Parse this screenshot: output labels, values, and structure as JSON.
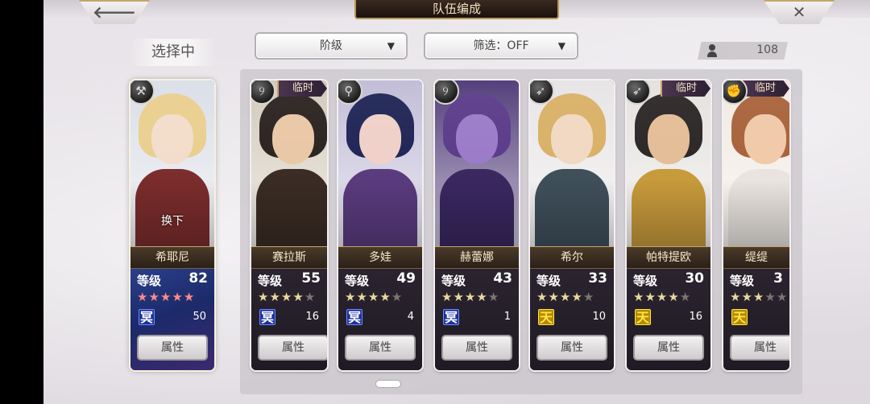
{
  "header": {
    "title": "队伍编成",
    "back_glyph": "🡐",
    "close_glyph": "✕"
  },
  "selecting_label": "选择中",
  "dropdowns": {
    "rank": {
      "label": "阶级",
      "caret": "▼"
    },
    "filter": {
      "label": "筛选：OFF",
      "caret": "▼"
    }
  },
  "roster_count": "108",
  "level_label": "等级",
  "attribute_label": "属性",
  "temp_label": "临时",
  "swap_label": "换下",
  "selected_card": {
    "name": "希耶尼",
    "level": "82",
    "stars": 5,
    "element": "冥",
    "element_type": "dark",
    "element_count": "50",
    "class_icon": "hammer-class-icon",
    "class_glyph": "⚒",
    "palette": {
      "hair": "#e9cf8e",
      "skin": "#f3dcca",
      "body": "#7b2c2c",
      "bg": "#d9dde6"
    }
  },
  "cards": [
    {
      "name": "赛拉斯",
      "level": "55",
      "stars": 4,
      "element": "冥",
      "element_type": "dark",
      "element_count": "16",
      "temp": true,
      "class_icon": "rod-class-icon",
      "class_glyph": "୨",
      "palette": {
        "hair": "#2a221f",
        "skin": "#e9c7a6",
        "body": "#3a2c24",
        "bg": "#d0c7b6"
      }
    },
    {
      "name": "多娃",
      "level": "49",
      "stars": 4,
      "element": "冥",
      "element_type": "dark",
      "element_count": "4",
      "temp": false,
      "class_icon": "staff-class-icon",
      "class_glyph": "⚲",
      "palette": {
        "hair": "#1e2454",
        "skin": "#f0d0c8",
        "body": "#5a3b7e",
        "bg": "#bfbad6"
      }
    },
    {
      "name": "赫蕾娜",
      "level": "43",
      "stars": 4,
      "element": "冥",
      "element_type": "dark",
      "element_count": "1",
      "temp": false,
      "class_icon": "rod-class-icon",
      "class_glyph": "୨",
      "palette": {
        "hair": "#5a3a8a",
        "skin": "#9a7ac8",
        "body": "#3a2760",
        "bg": "#4a3574"
      }
    },
    {
      "name": "希尔",
      "level": "33",
      "stars": 4,
      "element": "天",
      "element_type": "sky",
      "element_count": "10",
      "temp": false,
      "class_icon": "bow-class-icon",
      "class_glyph": "➶",
      "palette": {
        "hair": "#d9b066",
        "skin": "#f1d8c2",
        "body": "#3f4f5a",
        "bg": "#e6e3e4"
      }
    },
    {
      "name": "帕特提欧",
      "level": "30",
      "stars": 4,
      "element": "天",
      "element_type": "sky",
      "element_count": "16",
      "temp": true,
      "class_icon": "bow-class-icon",
      "class_glyph": "➶",
      "palette": {
        "hair": "#2b2626",
        "skin": "#e4bd96",
        "body": "#c79a3b",
        "bg": "#e3e0dc"
      }
    },
    {
      "name": "缇缇",
      "level": "3",
      "stars": 3,
      "element": "天",
      "element_type": "sky",
      "element_count": "",
      "temp": true,
      "class_icon": "fist-class-icon",
      "class_glyph": "✊",
      "palette": {
        "hair": "#a8623a",
        "skin": "#f0c9a8",
        "body": "#e9e4e0",
        "bg": "#f0e8e0"
      }
    }
  ]
}
